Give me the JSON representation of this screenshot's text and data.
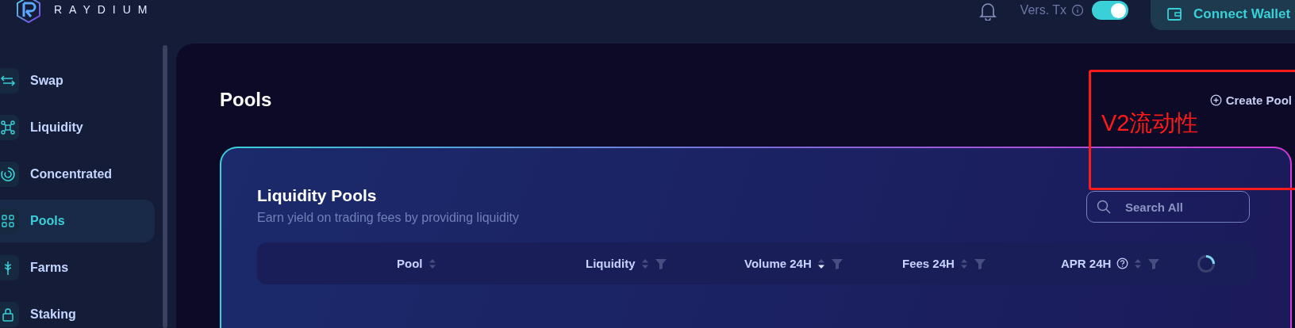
{
  "logo": {
    "text": "RAYDIUM"
  },
  "header": {
    "toggle": {
      "label": "Vers. Tx",
      "on": true
    },
    "connect_button": "Connect Wallet"
  },
  "sidebar": {
    "items": [
      {
        "label": "Swap",
        "selected": false
      },
      {
        "label": "Liquidity",
        "selected": false
      },
      {
        "label": "Concentrated",
        "selected": false
      },
      {
        "label": "Pools",
        "selected": true
      },
      {
        "label": "Farms",
        "selected": false
      },
      {
        "label": "Staking",
        "selected": false
      }
    ]
  },
  "page": {
    "title": "Pools",
    "create_button": "Create Pool"
  },
  "card": {
    "title": "Liquidity Pools",
    "subtitle": "Earn yield on trading fees by providing liquidity",
    "search": {
      "placeholder": "Search All"
    },
    "columns": [
      {
        "label": "Pool",
        "sorted_desc": false,
        "filter": false,
        "help": false
      },
      {
        "label": "Liquidity",
        "sorted_desc": false,
        "filter": true,
        "help": false
      },
      {
        "label": "Volume 24H",
        "sorted_desc": true,
        "filter": true,
        "help": false
      },
      {
        "label": "Fees 24H",
        "sorted_desc": false,
        "filter": true,
        "help": false
      },
      {
        "label": "APR 24H",
        "sorted_desc": false,
        "filter": true,
        "help": true
      }
    ]
  },
  "annotation": {
    "text": "V2流动性",
    "color": "#ff1a1a"
  }
}
